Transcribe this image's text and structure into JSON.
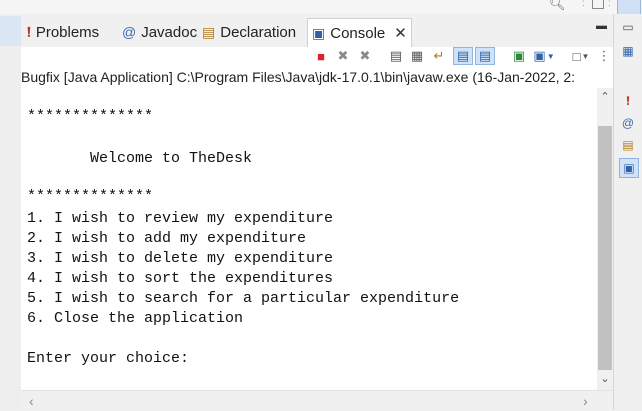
{
  "tabs": [
    {
      "label": "Problems",
      "icon": "problems-icon",
      "active": false
    },
    {
      "label": "Javadoc",
      "icon": "javadoc-icon",
      "active": false
    },
    {
      "label": "Declaration",
      "icon": "declaration-icon",
      "active": false
    },
    {
      "label": "Console",
      "icon": "console-icon",
      "active": true
    }
  ],
  "colors": {
    "accent": "#2f63a8",
    "terminate": "#e0202a",
    "selected_bg": "#cfe2f7"
  },
  "console": {
    "launch_info": "Bugfix [Java Application] C:\\Program Files\\Java\\jdk-17.0.1\\bin\\javaw.exe  (16-Jan-2022, 2:",
    "lines": [
      "**************",
      "",
      "       Welcome to TheDesk",
      "",
      "**************",
      "1. I wish to review my expenditure",
      "2. I wish to add my expenditure",
      "3. I wish to delete my expenditure",
      "4. I wish to sort the expenditures",
      "5. I wish to search for a particular expenditure",
      "6. Close the application",
      "",
      "Enter your choice:"
    ]
  }
}
